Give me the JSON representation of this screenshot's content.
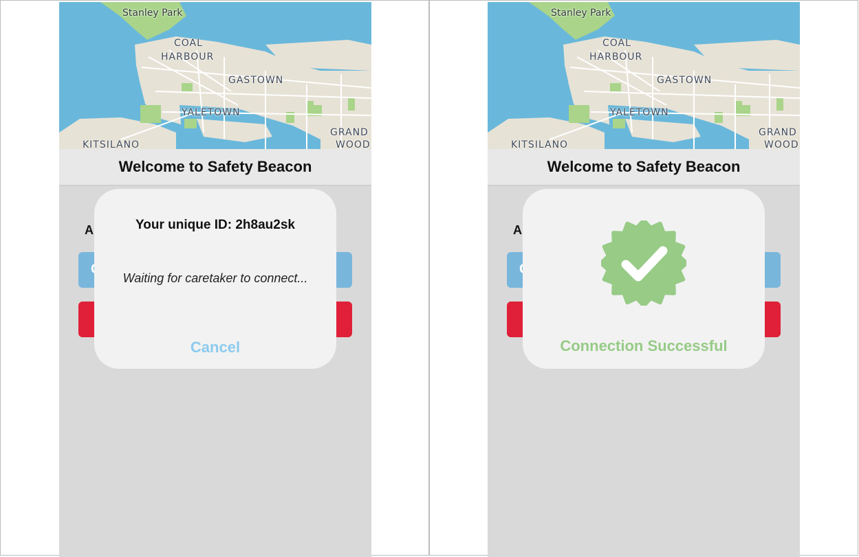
{
  "map": {
    "labels": {
      "stanley_park": "Stanley Park",
      "coal": "COAL",
      "harbour": "HARBOUR",
      "gastown": "GASTOWN",
      "yaletown": "YALETOWN",
      "grand": "GRAND",
      "wood": "WOOD",
      "kitsilano": "KITSILANO"
    }
  },
  "screens": [
    {
      "header": {
        "title": "Welcome to Safety Beacon"
      },
      "background": {
        "partial_label": "A",
        "blue_button_partial": "C"
      },
      "modal": {
        "id_text": "Your unique ID: 2h8au2sk",
        "waiting_text": "Waiting for caretaker to connect...",
        "cancel_label": "Cancel"
      }
    },
    {
      "header": {
        "title": "Welcome to Safety Beacon"
      },
      "background": {
        "partial_label": "A",
        "blue_button_partial": "C"
      },
      "modal": {
        "icon": "check-badge-icon",
        "status_text": "Connection Successful"
      }
    }
  ],
  "colors": {
    "water": "#69b8db",
    "land": "#e7e2d6",
    "park": "#a9d48a",
    "header_bg": "#e8e8e8",
    "screen_bg": "#d9d9d9",
    "modal_bg": "#f2f2f2",
    "cancel": "#8ccbee",
    "success": "#97cb86",
    "blue_button": "#79b6dc",
    "red_button": "#df2038"
  }
}
